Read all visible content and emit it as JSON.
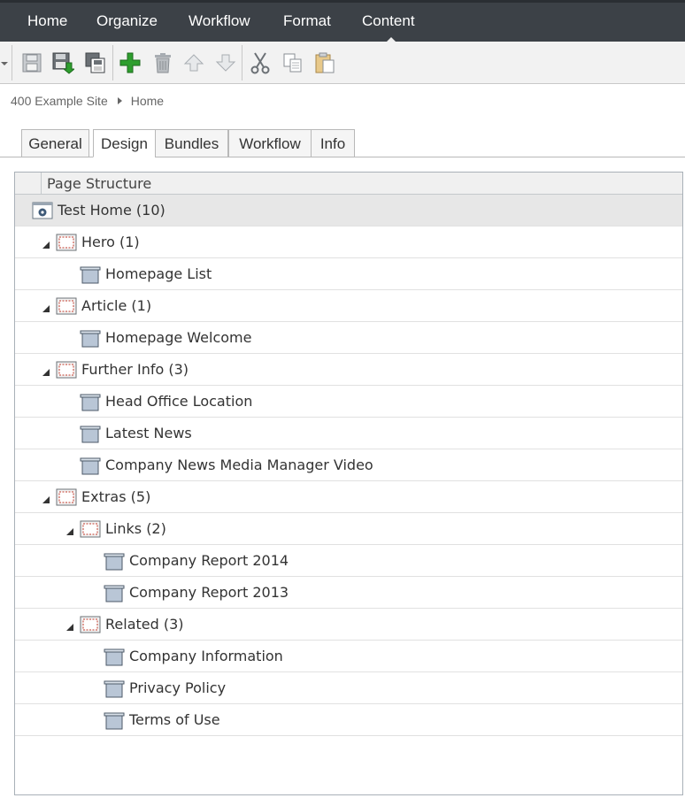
{
  "menubar": {
    "items": [
      "Home",
      "Organize",
      "Workflow",
      "Format",
      "Content"
    ]
  },
  "toolbar": {
    "buttons": [
      "save-icon",
      "save-publish-icon",
      "save-copy-icon",
      "add-icon",
      "delete-icon",
      "move-up-icon",
      "move-down-icon",
      "cut-icon",
      "copy-icon",
      "paste-icon"
    ]
  },
  "breadcrumb": {
    "site": "400 Example Site",
    "page": "Home"
  },
  "tabs": [
    "General",
    "Design",
    "Bundles",
    "Workflow",
    "Info"
  ],
  "active_tab": "Design",
  "tree": {
    "header": "Page Structure",
    "rows": [
      {
        "label": "Test Home (10)",
        "type": "page"
      },
      {
        "label": "Hero (1)",
        "type": "zone"
      },
      {
        "label": "Homepage List",
        "type": "item"
      },
      {
        "label": "Article (1)",
        "type": "zone"
      },
      {
        "label": "Homepage Welcome",
        "type": "item"
      },
      {
        "label": "Further Info (3)",
        "type": "zone"
      },
      {
        "label": "Head Office Location",
        "type": "item"
      },
      {
        "label": "Latest News",
        "type": "item"
      },
      {
        "label": "Company News Media Manager Video",
        "type": "item"
      },
      {
        "label": "Extras (5)",
        "type": "zone"
      },
      {
        "label": "Links (2)",
        "type": "zone"
      },
      {
        "label": "Company Report 2014",
        "type": "item"
      },
      {
        "label": "Company Report 2013",
        "type": "item"
      },
      {
        "label": "Related (3)",
        "type": "zone"
      },
      {
        "label": "Company Information",
        "type": "item"
      },
      {
        "label": "Privacy Policy",
        "type": "item"
      },
      {
        "label": "Terms of Use",
        "type": "item"
      }
    ]
  },
  "colors": {
    "menubar_bg": "#3c4147",
    "add_green": "#2e9e2e",
    "zone_red": "#c0392b",
    "item_blue": "#b9c6d6"
  }
}
